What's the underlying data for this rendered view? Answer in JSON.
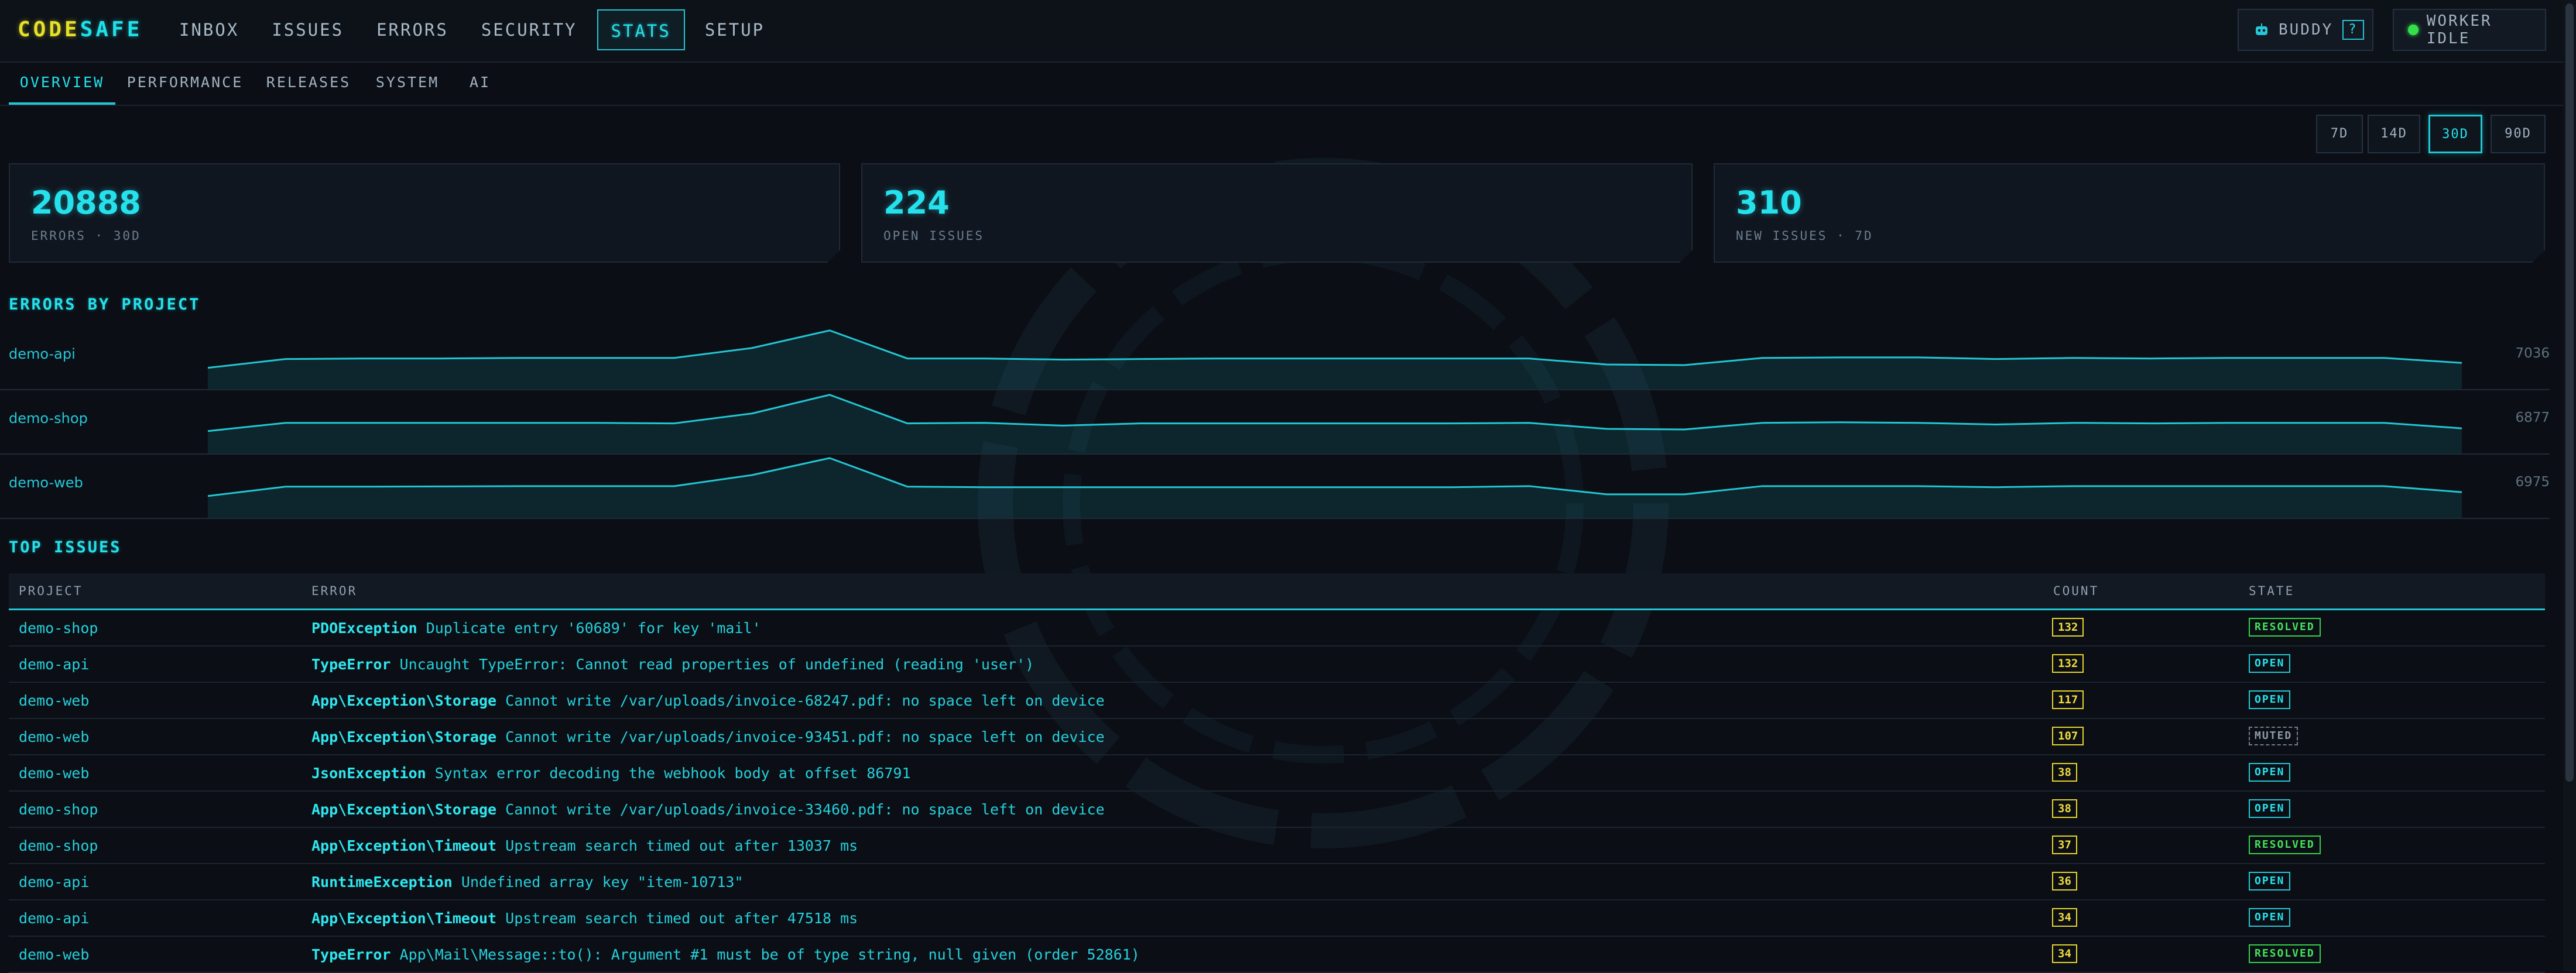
{
  "brand": {
    "part1": "CODE",
    "part2": "SAFE"
  },
  "nav": {
    "items": [
      {
        "label": "INBOX"
      },
      {
        "label": "ISSUES"
      },
      {
        "label": "ERRORS"
      },
      {
        "label": "SECURITY"
      },
      {
        "label": "STATS",
        "active": true
      },
      {
        "label": "SETUP"
      }
    ]
  },
  "buddy": {
    "label": "BUDDY",
    "count": "?",
    "icon": "robot-icon"
  },
  "worker": {
    "label": "WORKER IDLE",
    "status_color": "#34e04a"
  },
  "subnav": {
    "tabs": [
      {
        "label": "OVERVIEW",
        "active": true
      },
      {
        "label": "PERFORMANCE"
      },
      {
        "label": "RELEASES"
      },
      {
        "label": "SYSTEM"
      },
      {
        "label": "AI"
      }
    ]
  },
  "periods": [
    {
      "label": "7D"
    },
    {
      "label": "14D"
    },
    {
      "label": "30D",
      "active": true
    },
    {
      "label": "90D"
    }
  ],
  "stats": [
    {
      "value": "20888",
      "label": "ERRORS · 30D"
    },
    {
      "value": "224",
      "label": "OPEN ISSUES"
    },
    {
      "value": "310",
      "label": "NEW ISSUES · 7D"
    }
  ],
  "errors_by_project": {
    "title": "ERRORS BY PROJECT",
    "rows": [
      {
        "name": "demo-api",
        "total": "7036"
      },
      {
        "name": "demo-shop",
        "total": "6877"
      },
      {
        "name": "demo-web",
        "total": "6975"
      }
    ]
  },
  "chart_data": {
    "type": "area",
    "title": "ERRORS BY PROJECT",
    "x": [
      1,
      2,
      3,
      4,
      5,
      6,
      7,
      8,
      9,
      10,
      11,
      12,
      13,
      14,
      15,
      16,
      17,
      18,
      19,
      20,
      21,
      22,
      23,
      24,
      25,
      26,
      27,
      28,
      29,
      30
    ],
    "series": [
      {
        "name": "demo-api",
        "total": 7036,
        "values": [
          140,
          220,
          225,
          225,
          230,
          230,
          230,
          320,
          480,
          225,
          225,
          215,
          220,
          225,
          225,
          225,
          225,
          225,
          170,
          165,
          230,
          235,
          235,
          220,
          230,
          225,
          230,
          230,
          230,
          185
        ]
      },
      {
        "name": "demo-shop",
        "total": 6877,
        "values": [
          150,
          225,
          225,
          225,
          225,
          225,
          220,
          310,
          480,
          220,
          225,
          200,
          220,
          220,
          220,
          220,
          220,
          225,
          170,
          165,
          225,
          230,
          225,
          210,
          225,
          220,
          225,
          225,
          225,
          175
        ]
      },
      {
        "name": "demo-web",
        "total": 6975,
        "values": [
          145,
          230,
          230,
          232,
          235,
          235,
          235,
          335,
          490,
          230,
          225,
          225,
          225,
          225,
          225,
          225,
          225,
          235,
          160,
          160,
          235,
          235,
          235,
          225,
          235,
          235,
          235,
          235,
          235,
          180
        ]
      }
    ]
  },
  "top_issues": {
    "title": "TOP ISSUES",
    "columns": {
      "project": "PROJECT",
      "error": "ERROR",
      "count": "COUNT",
      "state": "STATE"
    },
    "rows": [
      {
        "project": "demo-shop",
        "type": "PDOException",
        "message": "Duplicate entry '60689' for key 'mail'",
        "count": "132",
        "state": "RESOLVED"
      },
      {
        "project": "demo-api",
        "type": "TypeError",
        "message": "Uncaught TypeError: Cannot read properties of undefined (reading 'user')",
        "count": "132",
        "state": "OPEN"
      },
      {
        "project": "demo-web",
        "type": "App\\Exception\\Storage",
        "message": "Cannot write /var/uploads/invoice-68247.pdf: no space left on device",
        "count": "117",
        "state": "OPEN"
      },
      {
        "project": "demo-web",
        "type": "App\\Exception\\Storage",
        "message": "Cannot write /var/uploads/invoice-93451.pdf: no space left on device",
        "count": "107",
        "state": "MUTED"
      },
      {
        "project": "demo-web",
        "type": "JsonException",
        "message": "Syntax error decoding the webhook body at offset 86791",
        "count": "38",
        "state": "OPEN"
      },
      {
        "project": "demo-shop",
        "type": "App\\Exception\\Storage",
        "message": "Cannot write /var/uploads/invoice-33460.pdf: no space left on device",
        "count": "38",
        "state": "OPEN"
      },
      {
        "project": "demo-shop",
        "type": "App\\Exception\\Timeout",
        "message": "Upstream search timed out after 13037 ms",
        "count": "37",
        "state": "RESOLVED"
      },
      {
        "project": "demo-api",
        "type": "RuntimeException",
        "message": "Undefined array key \"item-10713\"",
        "count": "36",
        "state": "OPEN"
      },
      {
        "project": "demo-api",
        "type": "App\\Exception\\Timeout",
        "message": "Upstream search timed out after 47518 ms",
        "count": "34",
        "state": "OPEN"
      },
      {
        "project": "demo-web",
        "type": "TypeError",
        "message": "App\\Mail\\Message::to(): Argument #1 must be of type string, null given (order 52861)",
        "count": "34",
        "state": "RESOLVED"
      }
    ]
  }
}
